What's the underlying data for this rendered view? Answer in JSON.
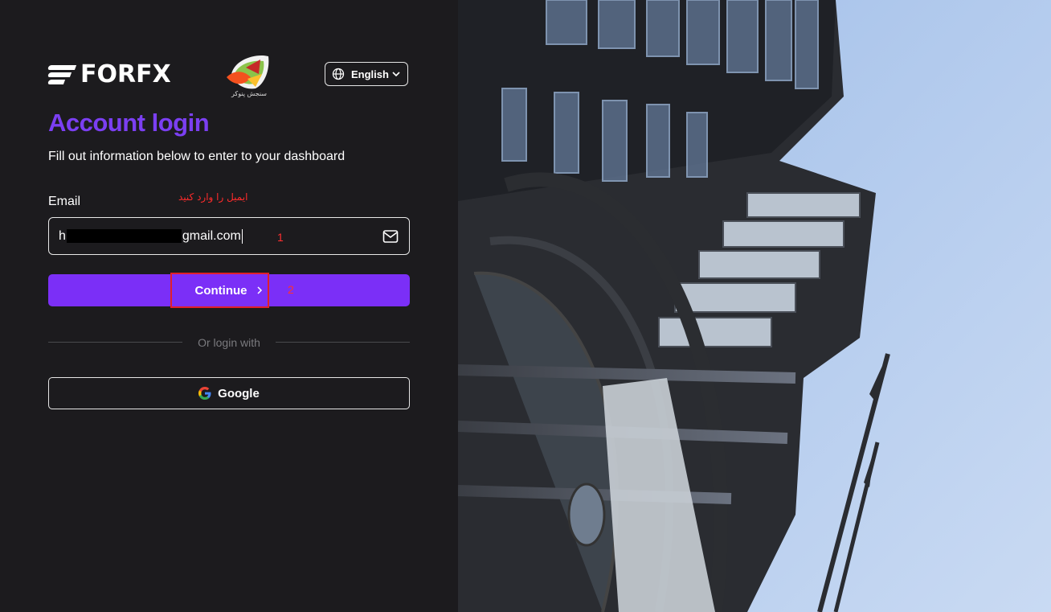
{
  "brand": {
    "name": "FORFX",
    "partner_caption": "سنجش پنوکر"
  },
  "language": {
    "selected": "English"
  },
  "login": {
    "title": "Account login",
    "subtitle": "Fill out information below to enter to your dashboard",
    "email_label": "Email",
    "email_value_prefix": "h",
    "email_value_suffix": "gmail.com",
    "continue_label": "Continue",
    "divider_text": "Or login with",
    "google_label": "Google"
  },
  "annotations": {
    "hint": "ایمیل را وارد کنید",
    "step1": "1",
    "step2": "2",
    "highlight_color": "#e0202a"
  },
  "colors": {
    "accent": "#7b2ff7",
    "title": "#7b3ff2",
    "background": "#1c1b1e"
  },
  "icons": {
    "language": "globe-icon",
    "dropdown": "chevron-down-icon",
    "email": "mail-icon",
    "continue": "chevron-right-icon",
    "google": "google-icon"
  },
  "background_image": {
    "subject": "building-photo"
  }
}
